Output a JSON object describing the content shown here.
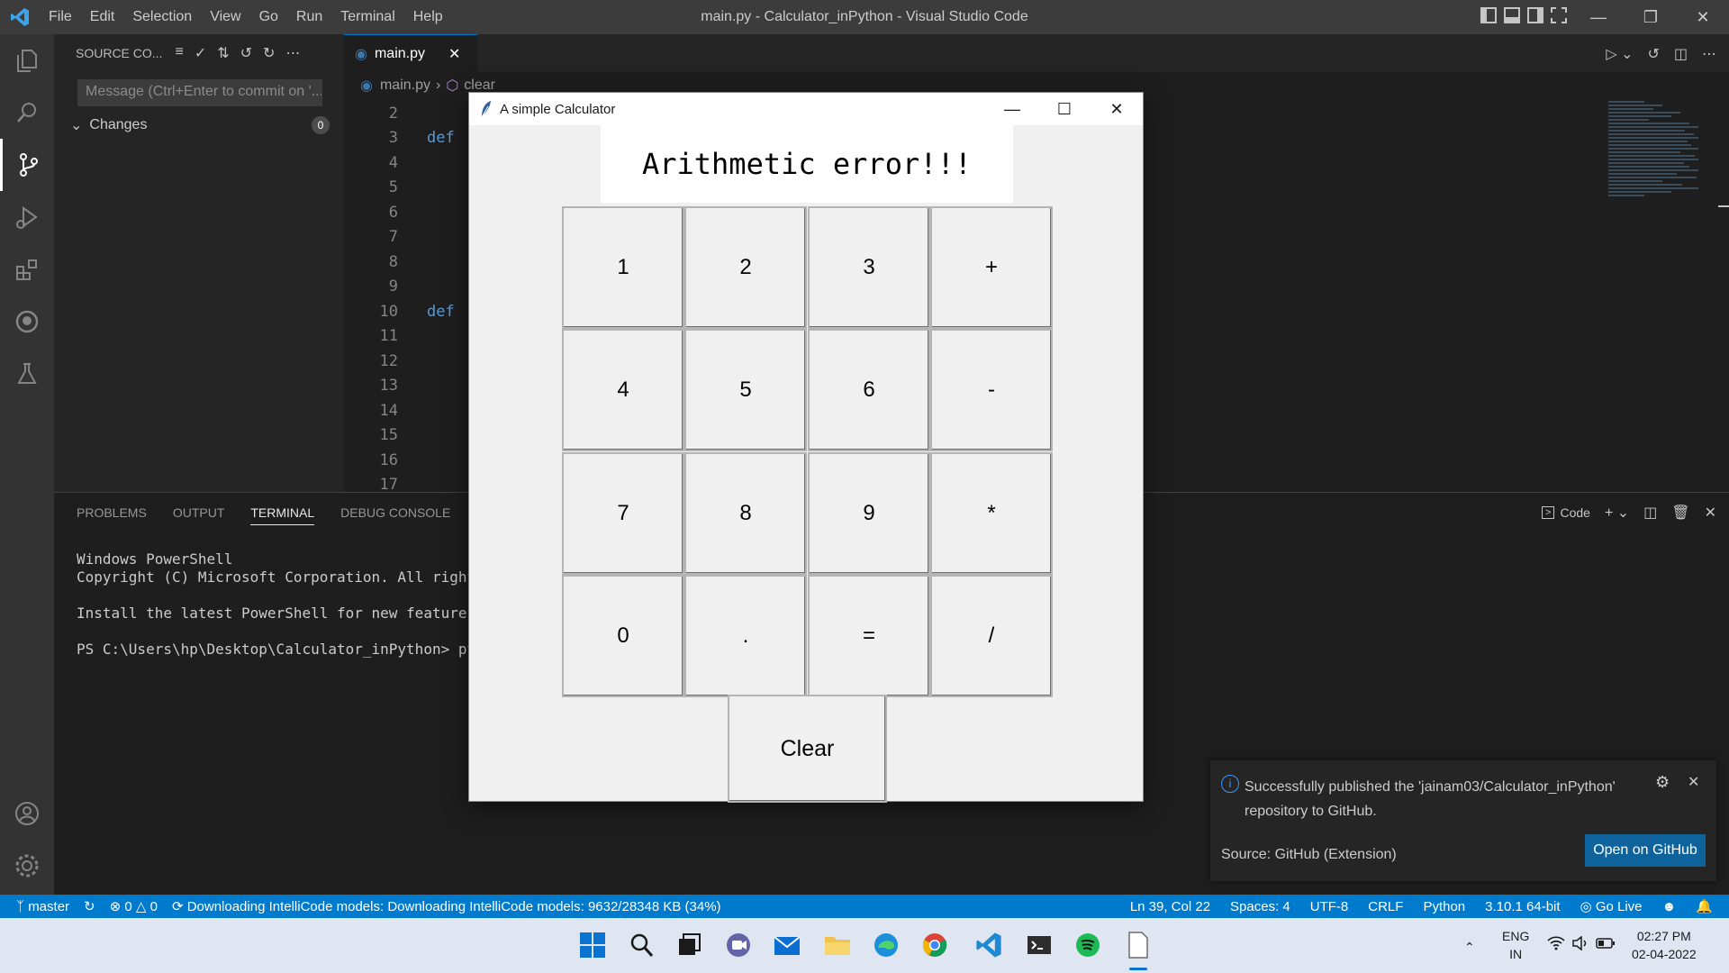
{
  "titlebar": {
    "menu": [
      "File",
      "Edit",
      "Selection",
      "View",
      "Go",
      "Run",
      "Terminal",
      "Help"
    ],
    "window_title": "main.py - Calculator_inPython - Visual Studio Code"
  },
  "sidebar": {
    "header": "SOURCE CO...",
    "commit_placeholder": "Message (Ctrl+Enter to commit on '...",
    "changes_label": "Changes",
    "changes_count": "0"
  },
  "editor": {
    "tab_label": "main.py",
    "breadcrumb_file": "main.py",
    "breadcrumb_symbol": "clear",
    "line_numbers": [
      "2",
      "3",
      "4",
      "5",
      "6",
      "7",
      "8",
      "9",
      "10",
      "11",
      "12",
      "13",
      "14",
      "15",
      "16",
      "17"
    ],
    "keywords": [
      {
        "line": "3",
        "text": "def"
      },
      {
        "line": "10",
        "text": "def"
      }
    ]
  },
  "panel": {
    "tabs": [
      "PROBLEMS",
      "OUTPUT",
      "TERMINAL",
      "DEBUG CONSOLE"
    ],
    "active_tab": "TERMINAL",
    "terminal_profile": "Code",
    "terminal_lines": [
      "Windows PowerShell",
      "Copyright (C) Microsoft Corporation. All rights",
      "",
      "Install the latest PowerShell for new features a",
      "",
      "PS C:\\Users\\hp\\Desktop\\Calculator_inPython> pyth"
    ]
  },
  "notification": {
    "message": "Successfully published the 'jainam03/Calculator_inPython' repository to GitHub.",
    "source": "Source: GitHub (Extension)",
    "button": "Open on GitHub"
  },
  "statusbar": {
    "branch": "master",
    "errors": "0",
    "warnings": "0",
    "progress": "Downloading IntelliCode models: Downloading IntelliCode models: 9632/28348 KB (34%)",
    "cursor": "Ln 39, Col 22",
    "spaces": "Spaces: 4",
    "encoding": "UTF-8",
    "eol": "CRLF",
    "language": "Python",
    "interpreter": "3.10.1 64-bit",
    "golive": "Go Live"
  },
  "taskbar": {
    "lang_top": "ENG",
    "lang_bottom": "IN",
    "time": "02:27 PM",
    "date": "02-04-2022"
  },
  "calculator": {
    "title": "A simple Calculator",
    "display": "Arithmetic error!!!",
    "keys": [
      [
        "1",
        "2",
        "3",
        "+"
      ],
      [
        "4",
        "5",
        "6",
        "-"
      ],
      [
        "7",
        "8",
        "9",
        "*"
      ],
      [
        "0",
        ".",
        "=",
        "/"
      ]
    ],
    "clear_label": "Clear"
  },
  "colors": {
    "accent": "#007acc",
    "button_blue": "#0e639c",
    "editor_bg": "#1e1e1e",
    "sidebar_bg": "#252526",
    "activity_bg": "#333333",
    "keyword": "#569cd6"
  }
}
